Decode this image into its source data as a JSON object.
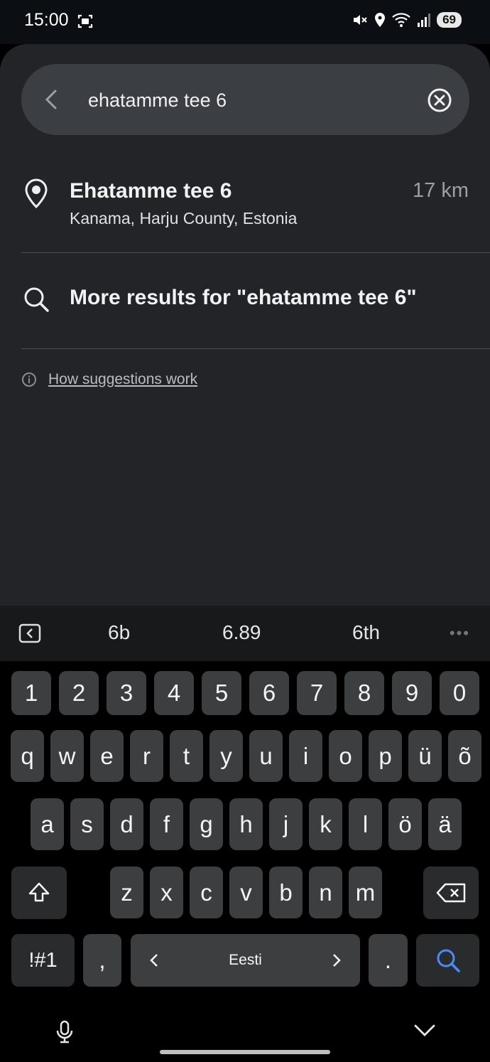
{
  "status": {
    "time": "15:00",
    "battery": "69"
  },
  "search": {
    "value": "ehatamme tee 6"
  },
  "result": {
    "title": "Ehatamme tee 6",
    "subtitle": "Kanama, Harju County, Estonia",
    "distance": "17 km"
  },
  "more_results": "More results for \"ehatamme tee 6\"",
  "how_link": "How suggestions work",
  "suggestions": [
    "6b",
    "6.89",
    "6th"
  ],
  "keyboard": {
    "row1": [
      "1",
      "2",
      "3",
      "4",
      "5",
      "6",
      "7",
      "8",
      "9",
      "0"
    ],
    "row2": [
      "q",
      "w",
      "e",
      "r",
      "t",
      "y",
      "u",
      "i",
      "o",
      "p",
      "ü",
      "õ"
    ],
    "row3": [
      "a",
      "s",
      "d",
      "f",
      "g",
      "h",
      "j",
      "k",
      "l",
      "ö",
      "ä"
    ],
    "row4": [
      "z",
      "x",
      "c",
      "v",
      "b",
      "n",
      "m"
    ],
    "symbols": "!#1",
    "comma": ",",
    "space_label": "Eesti",
    "period": "."
  },
  "accent_color": "#4a8cf7"
}
